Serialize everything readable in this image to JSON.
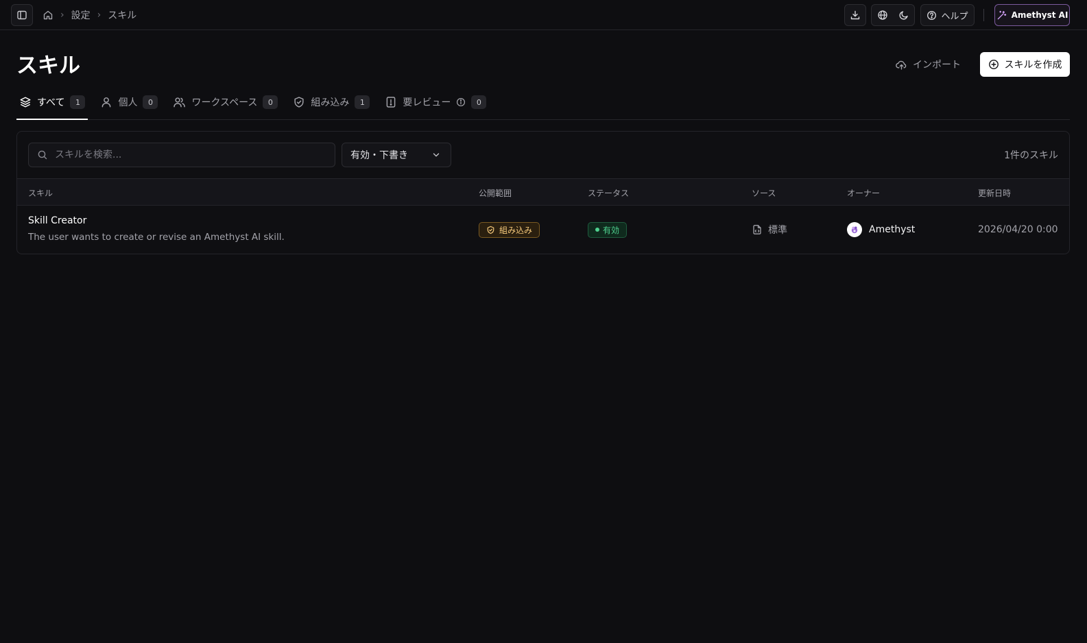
{
  "breadcrumb": {
    "settings": "設定",
    "current": "スキル"
  },
  "topbar": {
    "help_label": "ヘルプ",
    "ai_label": "Amethyst AI"
  },
  "page": {
    "title": "スキル",
    "import_label": "インポート",
    "create_label": "スキルを作成"
  },
  "tabs": [
    {
      "label": "すべて",
      "count": "1"
    },
    {
      "label": "個人",
      "count": "0"
    },
    {
      "label": "ワークスペース",
      "count": "0"
    },
    {
      "label": "組み込み",
      "count": "1"
    },
    {
      "label": "要レビュー",
      "count": "0"
    }
  ],
  "filters": {
    "search_placeholder": "スキルを検索...",
    "status_selected": "有効・下書き",
    "count_text": "1件のスキル"
  },
  "table": {
    "headers": {
      "skill": "スキル",
      "visibility": "公開範囲",
      "status": "ステータス",
      "source": "ソース",
      "owner": "オーナー",
      "updated": "更新日時"
    },
    "rows": [
      {
        "name": "Skill Creator",
        "description": "The user wants to create or revise an Amethyst AI skill.",
        "visibility": "組み込み",
        "status": "有効",
        "source": "標準",
        "owner": "Amethyst",
        "updated": "2026/04/20 0:00"
      }
    ]
  },
  "icons": {
    "sidebar": "sidebar-toggle-icon",
    "home": "home-icon",
    "download": "download-icon",
    "globe": "globe-icon",
    "theme": "moon-icon",
    "help": "help-circle-icon",
    "ai": "magic-wand-icon",
    "import": "cloud-upload-icon",
    "create": "plus-circle-icon",
    "search": "search-icon",
    "chevron": "chevron-down-icon"
  },
  "colors": {
    "background": "#0e0e11",
    "builtin_badge": "#f3c77a",
    "active_badge": "#4fd18f",
    "ai_border": "#7c5a9e"
  }
}
